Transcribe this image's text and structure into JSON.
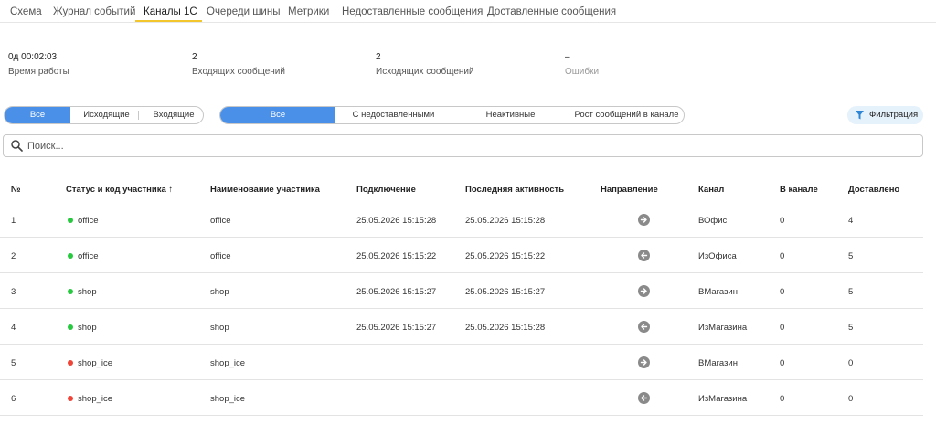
{
  "tabs": [
    {
      "label": "Схема",
      "active": false
    },
    {
      "label": "Журнал событий",
      "active": false
    },
    {
      "label": "Каналы 1С",
      "active": true
    },
    {
      "label": "Очереди шины",
      "active": false
    },
    {
      "label": "Метрики",
      "active": false
    },
    {
      "label": "Недоставленные сообщения",
      "active": false
    },
    {
      "label": "Доставленные сообщения",
      "active": false
    }
  ],
  "stats": [
    {
      "value": "0д 00:02:03",
      "label": "Время работы"
    },
    {
      "value": "2",
      "label": "Входящих сообщений"
    },
    {
      "value": "2",
      "label": "Исходящих сообщений"
    },
    {
      "value": "–",
      "label": "Ошибки"
    }
  ],
  "direction_filter": {
    "items": [
      "Все",
      "Исходящие",
      "Входящие"
    ],
    "selected": "Все"
  },
  "channel_filter": {
    "items": [
      "Все",
      "С недоставленными",
      "Неактивные",
      "Рост сообщений в канале"
    ],
    "selected": "Все"
  },
  "filter_button": {
    "label": "Фильтрация",
    "icon": "funnel-icon"
  },
  "search": {
    "placeholder": "Поиск...",
    "value": ""
  },
  "status_colors": {
    "active": "#27c93f",
    "inactive": "#f04438"
  },
  "accent_color": "#4a90e8",
  "table": {
    "columns": [
      "№",
      "Статус и код участника ↑",
      "Наименование участника",
      "Подключение",
      "Последняя активность",
      "Направление",
      "Канал",
      "В канале",
      "Доставлено"
    ],
    "rows": [
      {
        "num": "1",
        "status": "active",
        "code": "office",
        "name": "office",
        "connected": "25.05.2026 15:15:28",
        "last_activity": "25.05.2026 15:15:28",
        "direction": "outgoing",
        "channel": "ВОфис",
        "in_channel": "0",
        "delivered": "4"
      },
      {
        "num": "2",
        "status": "active",
        "code": "office",
        "name": "office",
        "connected": "25.05.2026 15:15:22",
        "last_activity": "25.05.2026 15:15:22",
        "direction": "incoming",
        "channel": "ИзОфиса",
        "in_channel": "0",
        "delivered": "5"
      },
      {
        "num": "3",
        "status": "active",
        "code": "shop",
        "name": "shop",
        "connected": "25.05.2026 15:15:27",
        "last_activity": "25.05.2026 15:15:27",
        "direction": "outgoing",
        "channel": "ВМагазин",
        "in_channel": "0",
        "delivered": "5"
      },
      {
        "num": "4",
        "status": "active",
        "code": "shop",
        "name": "shop",
        "connected": "25.05.2026 15:15:27",
        "last_activity": "25.05.2026 15:15:28",
        "direction": "incoming",
        "channel": "ИзМагазина",
        "in_channel": "0",
        "delivered": "5"
      },
      {
        "num": "5",
        "status": "inactive",
        "code": "shop_ice",
        "name": "shop_ice",
        "connected": "",
        "last_activity": "",
        "direction": "outgoing",
        "channel": "ВМагазин",
        "in_channel": "0",
        "delivered": "0"
      },
      {
        "num": "6",
        "status": "inactive",
        "code": "shop_ice",
        "name": "shop_ice",
        "connected": "",
        "last_activity": "",
        "direction": "incoming",
        "channel": "ИзМагазина",
        "in_channel": "0",
        "delivered": "0"
      }
    ]
  }
}
